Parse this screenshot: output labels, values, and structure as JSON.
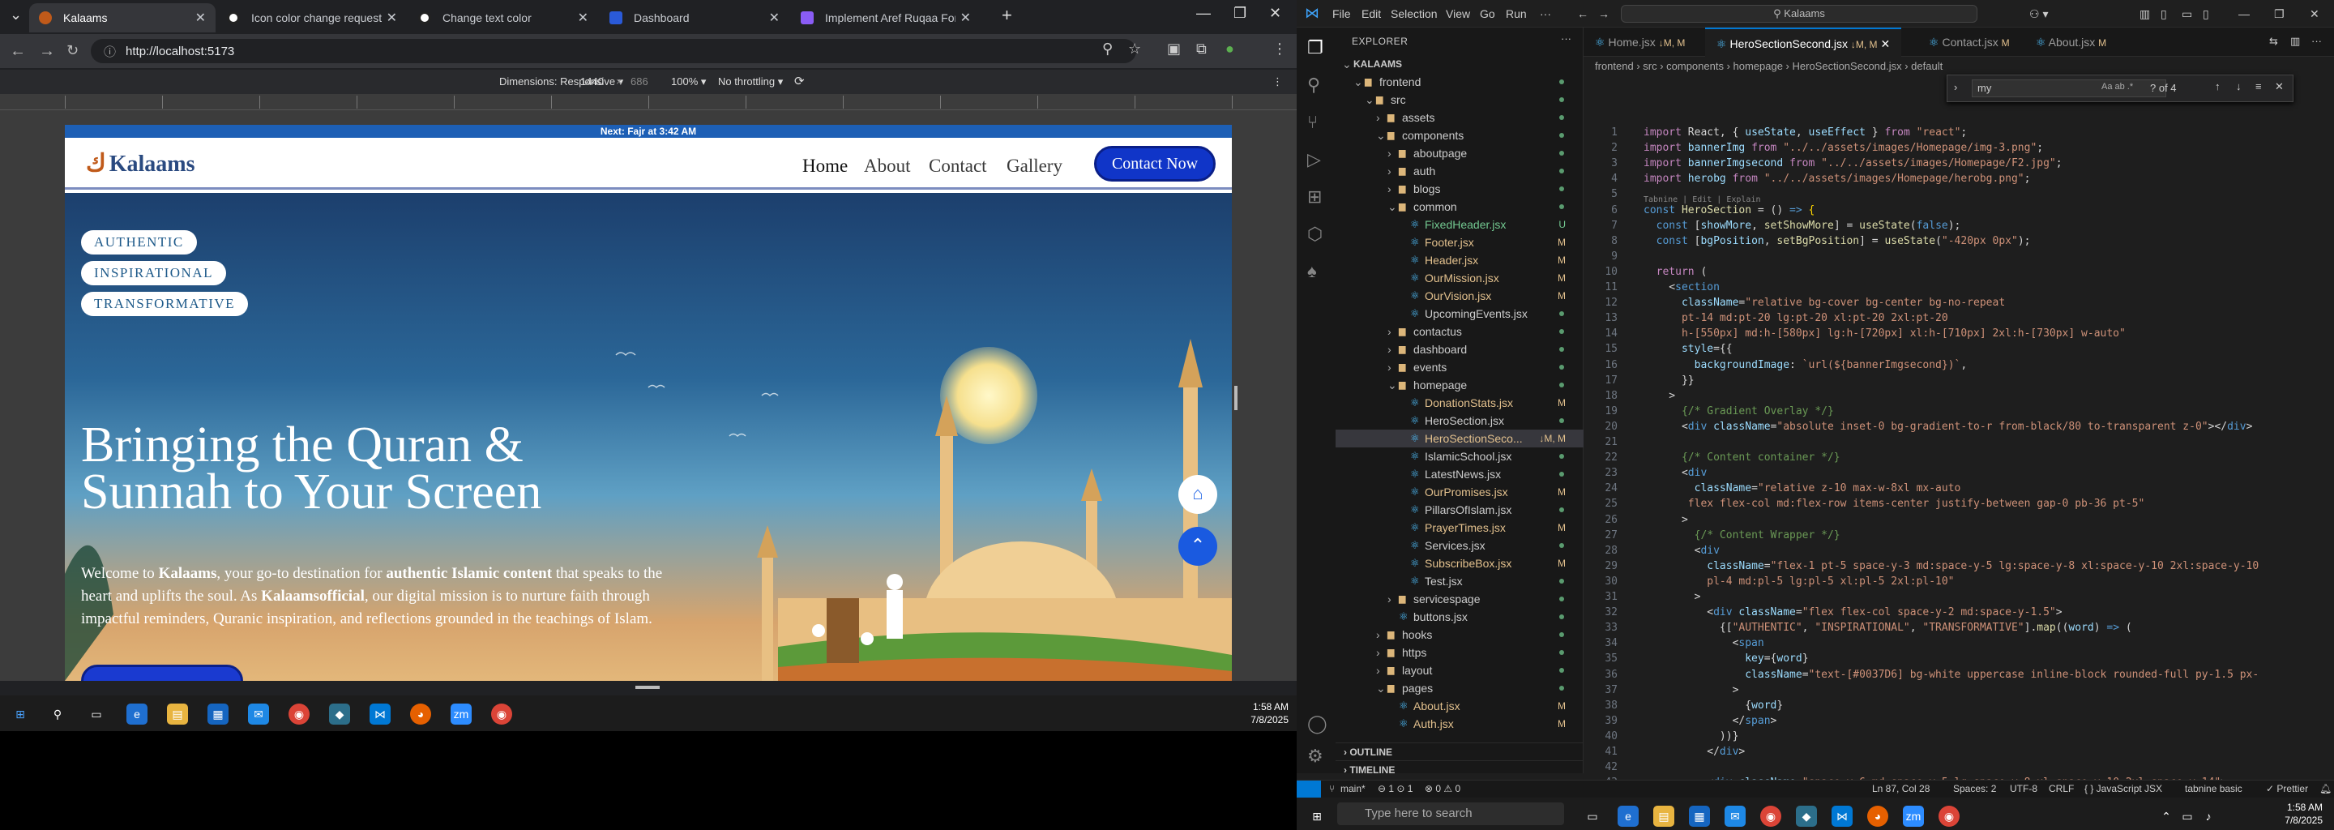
{
  "browser": {
    "tabs": [
      {
        "label": "Kalaams",
        "active": true
      },
      {
        "label": "Icon color change request",
        "active": false
      },
      {
        "label": "Change text color",
        "active": false
      },
      {
        "label": "Dashboard",
        "active": false
      },
      {
        "label": "Implement Aref Ruqaa Font in I",
        "active": false
      }
    ],
    "url": "http://localhost:5173",
    "devtools": {
      "dimensions": "Dimensions: Responsive ▾",
      "width": "1440",
      "x": "×",
      "height": "686",
      "zoom": "100% ▾",
      "throttle": "No throttling ▾"
    }
  },
  "site": {
    "prayer_bar": "Next: Fajr at 3:42 AM",
    "logo": "Kalaams",
    "nav": [
      "Home",
      "About",
      "Contact",
      "Gallery"
    ],
    "cta": "Contact Now",
    "pills": [
      "AUTHENTIC",
      "INSPIRATIONAL",
      "TRANSFORMATIVE"
    ],
    "title_line1": "Bringing the Quran &",
    "title_line2": "Sunnah to Your Screen",
    "para": {
      "p1": "Welcome to ",
      "b1": "Kalaams",
      "p2": ", your go-to destination for ",
      "b2": "authentic Islamic content",
      "p3": " that speaks to the heart and uplifts the soul. As ",
      "b3": "Kalaamsofficial",
      "p4": ", our digital mission is to nurture faith through impactful reminders, Quranic inspiration, and reflections grounded in the teachings of Islam."
    }
  },
  "taskbar_left": {
    "time": "1:58 AM",
    "date": "7/8/2025"
  },
  "vscode": {
    "menu": [
      "File",
      "Edit",
      "Selection",
      "View",
      "Go",
      "Run",
      "···"
    ],
    "search": "Kalaams",
    "explorer_title": "EXPLORER",
    "tree": [
      {
        "label": "KALAAMS",
        "depth": 0,
        "type": "root"
      },
      {
        "label": "frontend",
        "depth": 1,
        "type": "folder-open"
      },
      {
        "label": "src",
        "depth": 2,
        "type": "folder-open"
      },
      {
        "label": "assets",
        "depth": 3,
        "type": "folder"
      },
      {
        "label": "components",
        "depth": 3,
        "type": "folder-open"
      },
      {
        "label": "aboutpage",
        "depth": 4,
        "type": "folder"
      },
      {
        "label": "auth",
        "depth": 4,
        "type": "folder"
      },
      {
        "label": "blogs",
        "depth": 4,
        "type": "folder"
      },
      {
        "label": "common",
        "depth": 4,
        "type": "folder-open"
      },
      {
        "label": "FixedHeader.jsx",
        "depth": 5,
        "type": "file",
        "badge": "U"
      },
      {
        "label": "Footer.jsx",
        "depth": 5,
        "type": "file",
        "badge": "M"
      },
      {
        "label": "Header.jsx",
        "depth": 5,
        "type": "file",
        "badge": "M"
      },
      {
        "label": "OurMission.jsx",
        "depth": 5,
        "type": "file",
        "badge": "M"
      },
      {
        "label": "OurVision.jsx",
        "depth": 5,
        "type": "file",
        "badge": "M"
      },
      {
        "label": "UpcomingEvents.jsx",
        "depth": 5,
        "type": "file",
        "badge": ""
      },
      {
        "label": "contactus",
        "depth": 4,
        "type": "folder"
      },
      {
        "label": "dashboard",
        "depth": 4,
        "type": "folder"
      },
      {
        "label": "events",
        "depth": 4,
        "type": "folder"
      },
      {
        "label": "homepage",
        "depth": 4,
        "type": "folder-open"
      },
      {
        "label": "DonationStats.jsx",
        "depth": 5,
        "type": "file",
        "badge": "M"
      },
      {
        "label": "HeroSection.jsx",
        "depth": 5,
        "type": "file",
        "badge": ""
      },
      {
        "label": "HeroSectionSeco...",
        "depth": 5,
        "type": "file",
        "badge": "↓M, M",
        "selected": true
      },
      {
        "label": "IslamicSchool.jsx",
        "depth": 5,
        "type": "file",
        "badge": ""
      },
      {
        "label": "LatestNews.jsx",
        "depth": 5,
        "type": "file",
        "badge": ""
      },
      {
        "label": "OurPromises.jsx",
        "depth": 5,
        "type": "file",
        "badge": "M"
      },
      {
        "label": "PillarsOfIslam.jsx",
        "depth": 5,
        "type": "file",
        "badge": ""
      },
      {
        "label": "PrayerTimes.jsx",
        "depth": 5,
        "type": "file",
        "badge": "M"
      },
      {
        "label": "Services.jsx",
        "depth": 5,
        "type": "file",
        "badge": ""
      },
      {
        "label": "SubscribeBox.jsx",
        "depth": 5,
        "type": "file",
        "badge": "M"
      },
      {
        "label": "Test.jsx",
        "depth": 5,
        "type": "file",
        "badge": ""
      },
      {
        "label": "servicespage",
        "depth": 4,
        "type": "folder"
      },
      {
        "label": "buttons.jsx",
        "depth": 4,
        "type": "file",
        "badge": ""
      },
      {
        "label": "hooks",
        "depth": 3,
        "type": "folder"
      },
      {
        "label": "https",
        "depth": 3,
        "type": "folder"
      },
      {
        "label": "layout",
        "depth": 3,
        "type": "folder"
      },
      {
        "label": "pages",
        "depth": 3,
        "type": "folder-open"
      },
      {
        "label": "About.jsx",
        "depth": 4,
        "type": "file",
        "badge": "M"
      },
      {
        "label": "Auth.jsx",
        "depth": 4,
        "type": "file",
        "badge": "M"
      }
    ],
    "outline": "OUTLINE",
    "timeline": "TIMELINE",
    "editor_tabs": [
      {
        "label": "Home.jsx",
        "mark": "↓M, M"
      },
      {
        "label": "HeroSectionSecond.jsx",
        "mark": "↓M, M",
        "active": true
      },
      {
        "label": "Contact.jsx",
        "mark": "M"
      },
      {
        "label": "About.jsx",
        "mark": "M"
      }
    ],
    "breadcrumb": "frontend › src › components › homepage › HeroSectionSecond.jsx › default",
    "find": {
      "query": "my",
      "result": "? of 4"
    },
    "status": {
      "branch": "main*",
      "sync": "⊖ 1 ⊙ 1",
      "problems": "⊗ 0 ⚠ 0",
      "cursor": "Ln 87, Col 28",
      "spaces": "Spaces: 2",
      "encoding": "UTF-8",
      "eol": "CRLF",
      "lang": "{ } JavaScript JSX",
      "tabnine": "tabnine basic",
      "prettier": "✓ Prettier"
    }
  },
  "taskbar_right": {
    "search_placeholder": "Type here to search",
    "time": "1:58 AM",
    "date": "7/8/2025"
  }
}
